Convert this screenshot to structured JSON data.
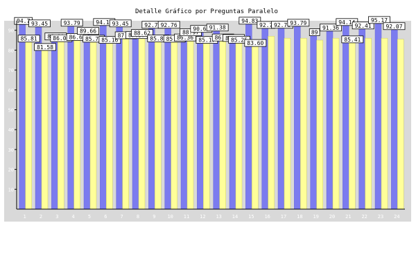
{
  "chart_data": {
    "type": "bar",
    "title": "Detalle Gráfico por Preguntas Paralelo",
    "xlabel": "",
    "ylabel": "",
    "ylim": [
      0,
      100
    ],
    "yticks": [
      10,
      20,
      30,
      40,
      50,
      60,
      70,
      80,
      90
    ],
    "grid": false,
    "legend": "none",
    "categories": [
      "1",
      "2",
      "3",
      "4",
      "5",
      "6",
      "7",
      "8",
      "9",
      "10",
      "11",
      "12",
      "13",
      "14",
      "15",
      "16",
      "17",
      "18",
      "19",
      "20",
      "21",
      "22",
      "23",
      "24"
    ],
    "series": [
      {
        "color": "#7b7bef",
        "values": [
          94.7,
          93.45,
          86.9,
          93.79,
          89.66,
          94.14,
          93.45,
          87.57,
          92.76,
          92.76,
          86.36,
          90.69,
          91.38,
          86.13,
          94.83,
          92.7,
          92.76,
          93.79,
          89.0,
          91.36,
          94.14,
          92.41,
          95.17,
          92.07
        ],
        "labels": [
          "94.7",
          "93.45",
          "86.90",
          "93.79",
          "89.66",
          "94.14",
          "93.45",
          "87.57",
          "92.76",
          "92.76",
          "86.36",
          "90.69",
          "91.38",
          "86.13",
          "94.83",
          "92.7",
          "92.76",
          "93.79",
          "89",
          "91.36",
          "94.14",
          "92.41",
          "95.17",
          "92.07"
        ]
      },
      {
        "color": "#ffff99",
        "values": [
          85.81,
          81.58,
          86.0,
          86.62,
          85.77,
          85.16,
          87.46,
          88.62,
          85.88,
          85.75,
          88.97,
          85.17,
          86.35,
          85.25,
          83.6,
          87.0,
          86.0,
          86.0,
          85.0,
          86.0,
          85.41,
          86.0,
          86.0,
          85.5
        ],
        "labels": [
          "85.81",
          "81.58",
          "86.00",
          "86.62",
          "85.77",
          "85.16",
          "87.46",
          "88.62",
          "85.88",
          "85.75",
          "88.97",
          "85.17",
          "86.35",
          "85.25",
          "83.60",
          "",
          "",
          "",
          "",
          "",
          "85.41",
          "",
          "",
          ""
        ]
      }
    ]
  },
  "colors": {
    "plot_background": "#d9d9d9",
    "page_background": "#ffffff",
    "axis": "#000000",
    "tick_label": "#ffffff",
    "title": "#000000"
  }
}
